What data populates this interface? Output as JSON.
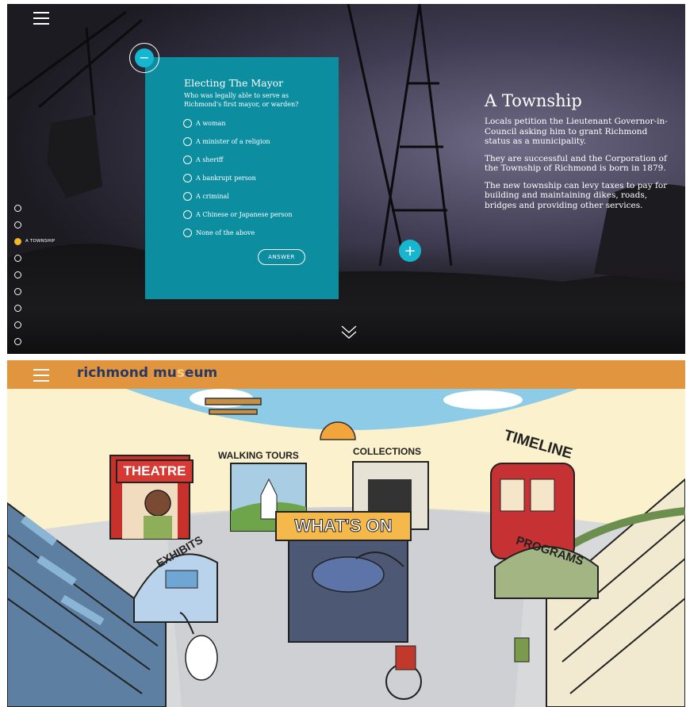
{
  "top": {
    "menu_icon": "hamburger-icon",
    "quiz": {
      "title": "Electing The Mayor",
      "question": "Who was legally able to serve as Richmond's first mayor, or warden?",
      "options": [
        "A woman",
        "A minister of a religion",
        "A sheriff",
        "A bankrupt person",
        "A criminal",
        "A Chinese or Japanese person",
        "None of the above"
      ],
      "answer_label": "ANSWER",
      "collapse_icon": "minus-icon"
    },
    "article": {
      "title": "A Township",
      "p1": "Locals petition the Lieutenant Governor-in-Council asking him to grant Richmond status as a municipality.",
      "p2": "They are successful and the Corporation of the Township of Richmond is born in 1879.",
      "p3": "The new township can levy taxes to pay for building and maintaining dikes, roads, bridges and providing other services."
    },
    "expand_icon": "plus-icon",
    "scroll_icon": "chevron-down-icon",
    "nav": {
      "active_label": "A TOWNSHIP",
      "count": 10,
      "active_index": 2
    },
    "colors": {
      "panel": "#0d8ea0",
      "accent": "#16b6d0",
      "active_dot": "#f2b82a"
    }
  },
  "bottom": {
    "menu_icon": "hamburger-icon",
    "logo_part1": "richmond mu",
    "logo_part2": "s",
    "logo_part3": "eum",
    "signs": {
      "theatre": "THEATRE",
      "walking_tours": "WALKING TOURS",
      "collections": "COLLECTIONS",
      "timeline": "TIMELINE",
      "whats_on": "WHAT'S ON",
      "exhibits": "EXHIBITS",
      "programs": "PROGRAMS"
    },
    "colors": {
      "header": "#e2953f",
      "logo": "#283a63",
      "logo_accent": "#e2953f",
      "bg": "#fbf1cc"
    }
  }
}
